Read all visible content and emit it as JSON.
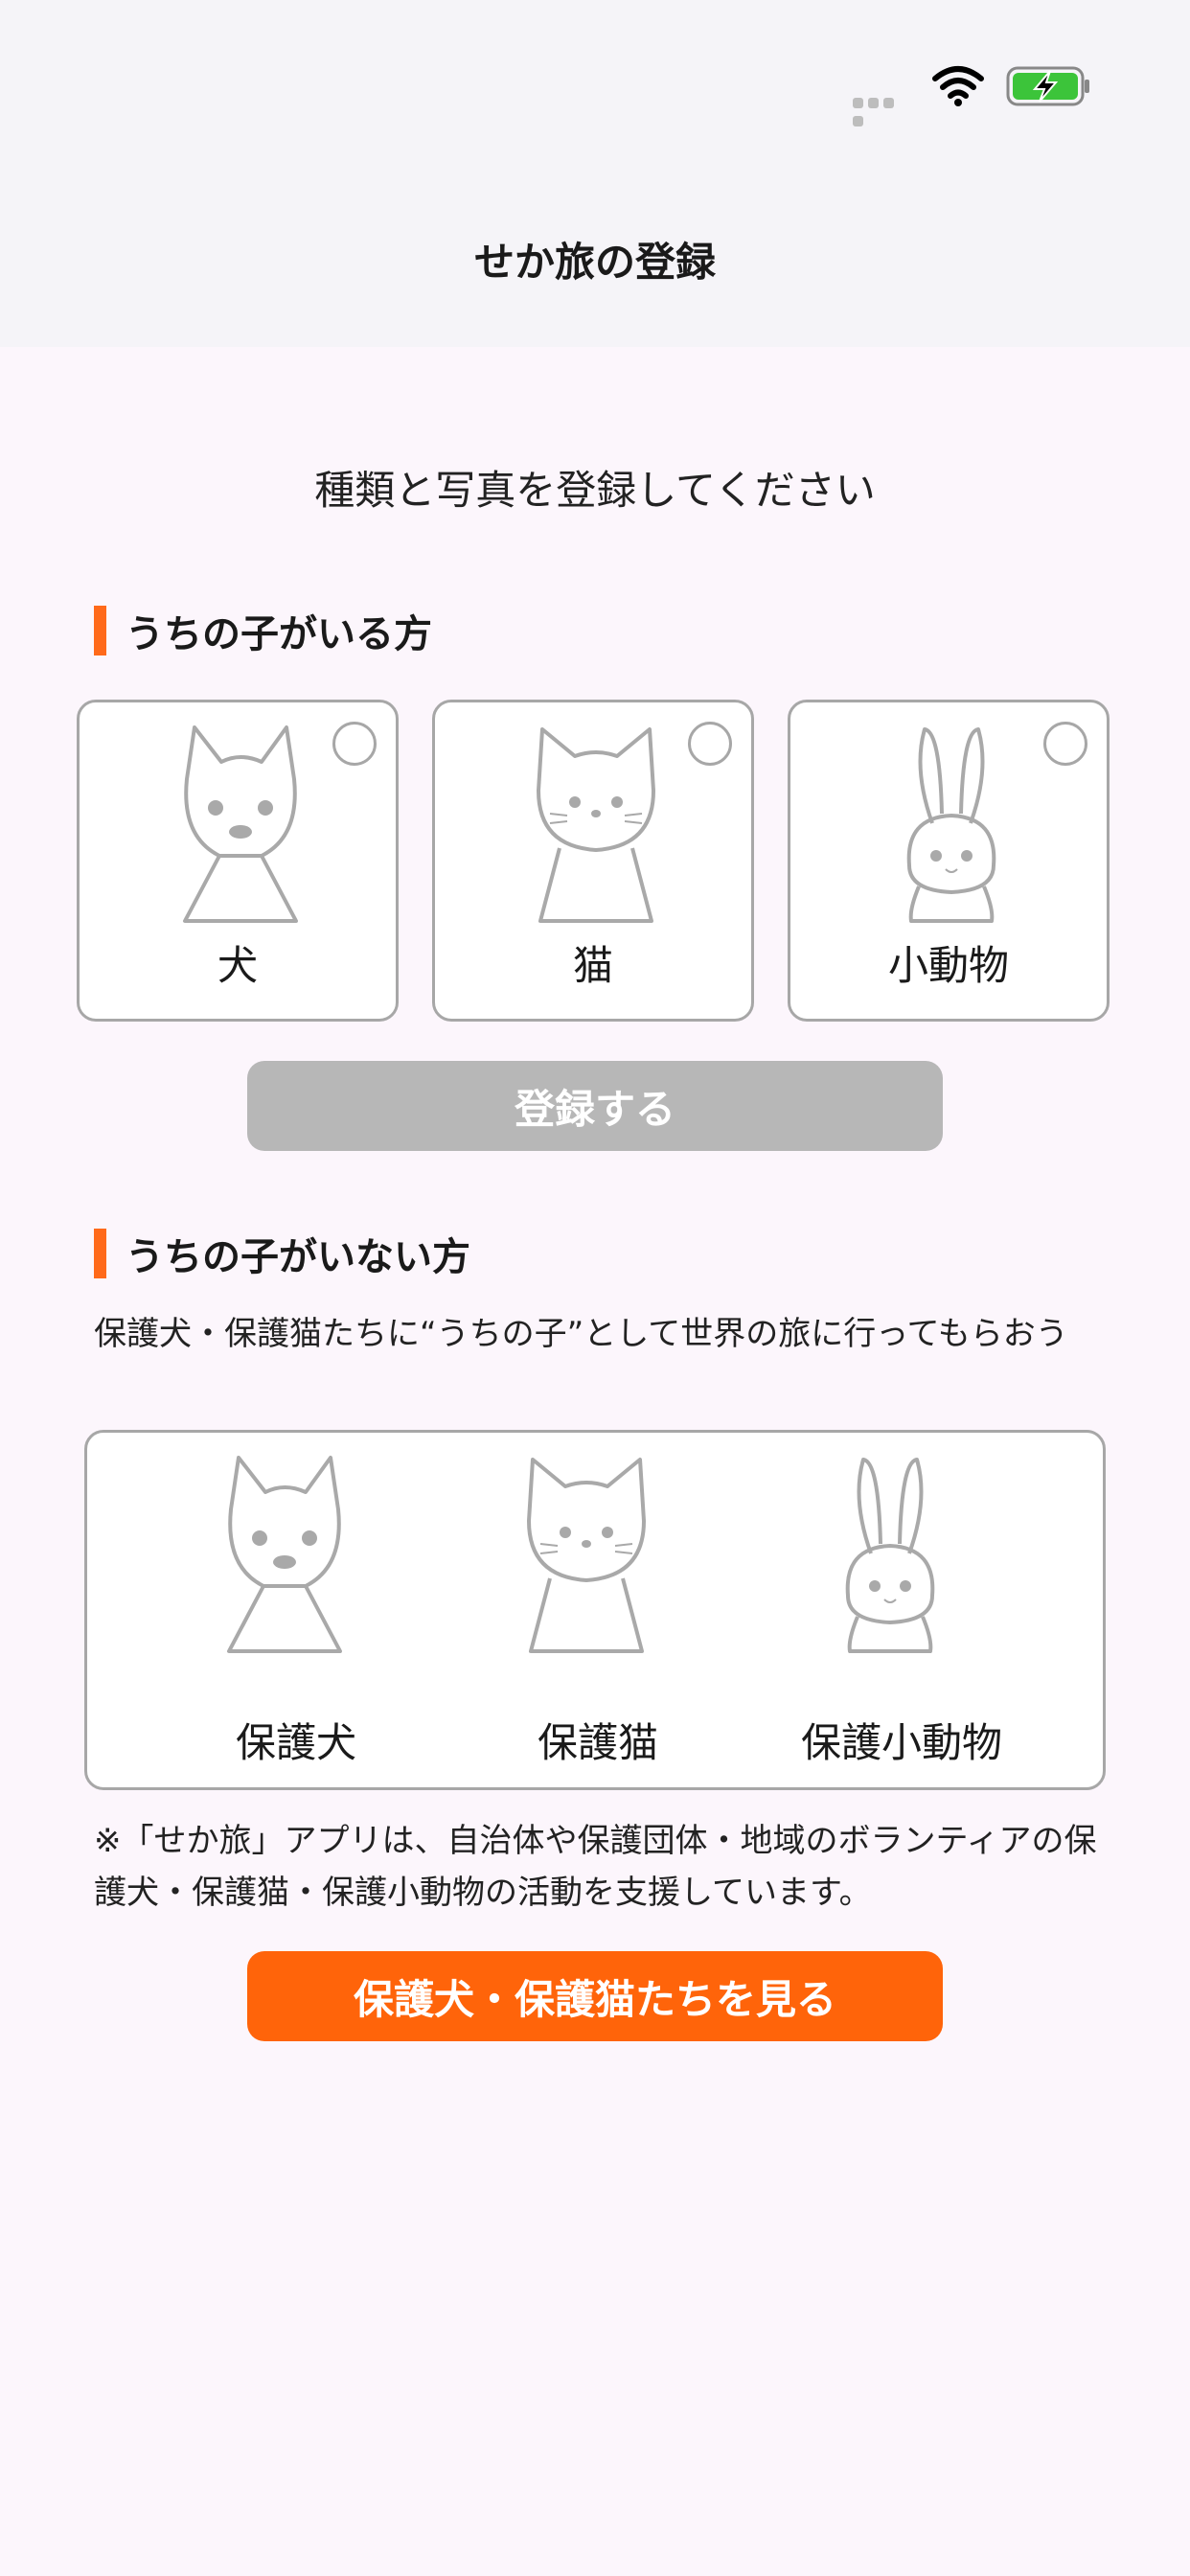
{
  "header": {
    "title": "せか旅の登録"
  },
  "subtitle": "種類と写真を登録してください",
  "owner_section": {
    "title": "うちの子がいる方",
    "options": [
      {
        "label": "犬",
        "icon": "dog-icon"
      },
      {
        "label": "猫",
        "icon": "cat-icon"
      },
      {
        "label": "小動物",
        "icon": "rabbit-icon"
      }
    ],
    "register_label": "登録する"
  },
  "no_pet_section": {
    "title": "うちの子がいない方",
    "description": "保護犬・保護猫たちに“うちの子”として世界の旅に行ってもらおう",
    "items": [
      {
        "label": "保護犬",
        "icon": "dog-icon"
      },
      {
        "label": "保護猫",
        "icon": "cat-icon"
      },
      {
        "label": "保護小動物",
        "icon": "rabbit-icon"
      }
    ],
    "note": "※「せか旅」アプリは、自治体や保護団体・地域のボランティアの保護犬・保護猫・保護小動物の活動を支援しています。",
    "view_label": "保護犬・保護猫たちを見る"
  },
  "colors": {
    "accent": "#ff640a",
    "disabled": "#b7b7b7",
    "background": "#fcf6fc"
  }
}
